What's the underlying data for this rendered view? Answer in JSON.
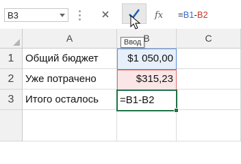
{
  "formula_bar": {
    "name_box": "B3",
    "cancel_icon": "x-icon",
    "enter_icon": "checkmark-icon",
    "function_label": "fx",
    "formula_parts": {
      "equals": "=",
      "ref1": "B1",
      "minus": "-",
      "ref2": "B2"
    }
  },
  "tooltip": "Ввод",
  "columns": [
    "A",
    "B",
    "C"
  ],
  "rows": [
    {
      "num": "1",
      "a": "Общий бюджет",
      "b": "$1 050,00"
    },
    {
      "num": "2",
      "a": "Уже потрачено",
      "b": "$315,23"
    },
    {
      "num": "3",
      "a": "Итого осталось",
      "b": "=B1-B2"
    }
  ],
  "colors": {
    "ref1": "#2f6fc9",
    "ref2": "#c0392b",
    "active_border": "#1e7145",
    "enter_check": "#1f5fae"
  }
}
